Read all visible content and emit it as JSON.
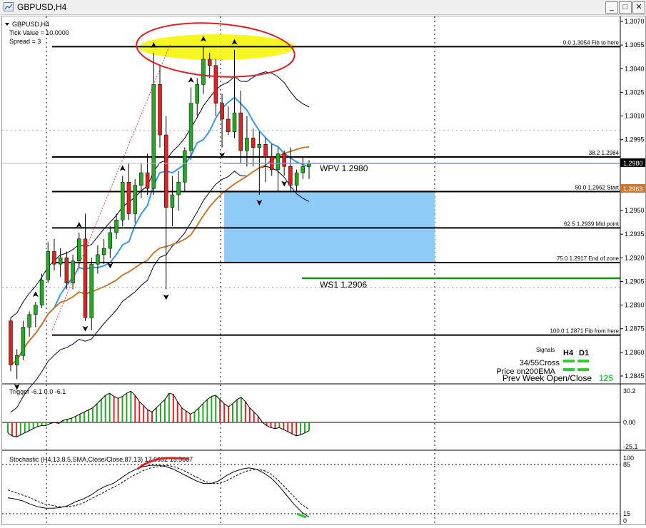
{
  "window": {
    "title": "GBPUSD,H4",
    "minimize": "_",
    "maximize": "□",
    "close": "✕"
  },
  "info": {
    "symbol": "GBPUSD,H4",
    "tick_value": "Tick Value = 10.0000",
    "spread": "Spread = 3"
  },
  "price_axis": [
    "1.3070",
    "1.3055",
    "1.3040",
    "1.3025",
    "1.3010",
    "1.2995",
    "1.2980",
    "1.2965",
    "1.2950",
    "1.2935",
    "1.2920",
    "1.2905",
    "1.2890",
    "1.2875",
    "1.2860",
    "1.2845"
  ],
  "current_price_tag": "1.2980",
  "orange_price_tag": "1.2963",
  "fib_levels": [
    {
      "label": "0.0   1.3054   Fib to here",
      "price": 1.3054
    },
    {
      "label": "38.2  1.2984",
      "price": 1.2984
    },
    {
      "label": "50.0   1.2962   Start",
      "price": 1.2962
    },
    {
      "label": "62.5   1.2939   Mid point",
      "price": 1.2939
    },
    {
      "label": "75.0   1.2917   End of zone",
      "price": 1.2917
    },
    {
      "label": "100.0   1.2871   Fib from here",
      "price": 1.2871
    }
  ],
  "pivots": {
    "wpv": "WPV   1.2980",
    "ws1": "WS1   1.2906"
  },
  "signals": {
    "title": "Signals",
    "col1": "H4",
    "col2": "D1",
    "rows": [
      "34/55Cross",
      "Price on200EMA"
    ],
    "prev_week": "Prev Week Open/Close",
    "prev_week_value": "125",
    "colors": {
      "signal": "#33cc33",
      "value": "#2ecc40"
    }
  },
  "trigger": {
    "label": "Trigger -6.1 0.0 -6.1",
    "axis": [
      "30.2",
      "0.00",
      "-25.1"
    ]
  },
  "stochastic": {
    "label": "Stochastic (H4,13,8,5,SMA,Close/Close,87,13) 17.9932 13.5667",
    "axis": [
      "100",
      "85",
      "15",
      "0"
    ]
  },
  "candles": [
    {
      "o": 1.288,
      "h": 1.2882,
      "l": 1.2848,
      "c": 1.2852
    },
    {
      "o": 1.2852,
      "h": 1.2862,
      "l": 1.2843,
      "c": 1.2858
    },
    {
      "o": 1.2858,
      "h": 1.288,
      "l": 1.2855,
      "c": 1.2876
    },
    {
      "o": 1.2876,
      "h": 1.2886,
      "l": 1.287,
      "c": 1.2884
    },
    {
      "o": 1.2884,
      "h": 1.2892,
      "l": 1.2876,
      "c": 1.289
    },
    {
      "o": 1.289,
      "h": 1.291,
      "l": 1.2888,
      "c": 1.2906
    },
    {
      "o": 1.2906,
      "h": 1.293,
      "l": 1.2904,
      "c": 1.2924
    },
    {
      "o": 1.2924,
      "h": 1.2932,
      "l": 1.2912,
      "c": 1.2916
    },
    {
      "o": 1.2916,
      "h": 1.2926,
      "l": 1.2908,
      "c": 1.292
    },
    {
      "o": 1.292,
      "h": 1.2924,
      "l": 1.29,
      "c": 1.2904
    },
    {
      "o": 1.2904,
      "h": 1.2922,
      "l": 1.29,
      "c": 1.2918
    },
    {
      "o": 1.2918,
      "h": 1.2936,
      "l": 1.2914,
      "c": 1.2932
    },
    {
      "o": 1.2932,
      "h": 1.2948,
      "l": 1.288,
      "c": 1.2882
    },
    {
      "o": 1.2882,
      "h": 1.292,
      "l": 1.2874,
      "c": 1.2916
    },
    {
      "o": 1.2916,
      "h": 1.2928,
      "l": 1.291,
      "c": 1.2922
    },
    {
      "o": 1.2922,
      "h": 1.2932,
      "l": 1.2916,
      "c": 1.2926
    },
    {
      "o": 1.2926,
      "h": 1.294,
      "l": 1.292,
      "c": 1.2936
    },
    {
      "o": 1.2936,
      "h": 1.2948,
      "l": 1.2932,
      "c": 1.2944
    },
    {
      "o": 1.2944,
      "h": 1.2972,
      "l": 1.294,
      "c": 1.2968
    },
    {
      "o": 1.2968,
      "h": 1.298,
      "l": 1.2944,
      "c": 1.2948
    },
    {
      "o": 1.2948,
      "h": 1.297,
      "l": 1.2942,
      "c": 1.2966
    },
    {
      "o": 1.2966,
      "h": 1.298,
      "l": 1.2958,
      "c": 1.2974
    },
    {
      "o": 1.2974,
      "h": 1.2986,
      "l": 1.296,
      "c": 1.2964
    },
    {
      "o": 1.2964,
      "h": 1.305,
      "l": 1.296,
      "c": 1.303
    },
    {
      "o": 1.303,
      "h": 1.3042,
      "l": 1.299,
      "c": 1.2998
    },
    {
      "o": 1.2998,
      "h": 1.301,
      "l": 1.29,
      "c": 1.2952
    },
    {
      "o": 1.2952,
      "h": 1.2972,
      "l": 1.294,
      "c": 1.296
    },
    {
      "o": 1.296,
      "h": 1.2975,
      "l": 1.295,
      "c": 1.2968
    },
    {
      "o": 1.2968,
      "h": 1.299,
      "l": 1.2962,
      "c": 1.2988
    },
    {
      "o": 1.2988,
      "h": 1.3028,
      "l": 1.2982,
      "c": 1.3018
    },
    {
      "o": 1.3018,
      "h": 1.3034,
      "l": 1.301,
      "c": 1.303
    },
    {
      "o": 1.303,
      "h": 1.3054,
      "l": 1.3024,
      "c": 1.3046
    },
    {
      "o": 1.3046,
      "h": 1.305,
      "l": 1.3034,
      "c": 1.3042
    },
    {
      "o": 1.3042,
      "h": 1.3046,
      "l": 1.301,
      "c": 1.3018
    },
    {
      "o": 1.3018,
      "h": 1.3024,
      "l": 1.299,
      "c": 1.3008
    },
    {
      "o": 1.3008,
      "h": 1.3016,
      "l": 1.2998,
      "c": 1.3
    },
    {
      "o": 1.3,
      "h": 1.3052,
      "l": 1.2996,
      "c": 1.3012
    },
    {
      "o": 1.3012,
      "h": 1.3026,
      "l": 1.298,
      "c": 1.2988
    },
    {
      "o": 1.2988,
      "h": 1.301,
      "l": 1.2978,
      "c": 1.2996
    },
    {
      "o": 1.2996,
      "h": 1.3002,
      "l": 1.2978,
      "c": 1.299
    },
    {
      "o": 1.299,
      "h": 1.3,
      "l": 1.296,
      "c": 1.2992
    },
    {
      "o": 1.2992,
      "h": 1.2996,
      "l": 1.2968,
      "c": 1.2984
    },
    {
      "o": 1.2984,
      "h": 1.2992,
      "l": 1.2972,
      "c": 1.2976
    },
    {
      "o": 1.2976,
      "h": 1.299,
      "l": 1.2962,
      "c": 1.2986
    },
    {
      "o": 1.2986,
      "h": 1.2988,
      "l": 1.2972,
      "c": 1.2978
    },
    {
      "o": 1.2978,
      "h": 1.299,
      "l": 1.2962,
      "c": 1.2966
    },
    {
      "o": 1.2966,
      "h": 1.2976,
      "l": 1.2962,
      "c": 1.2974
    },
    {
      "o": 1.2974,
      "h": 1.2984,
      "l": 1.297,
      "c": 1.2978
    },
    {
      "o": 1.2978,
      "h": 1.2982,
      "l": 1.297,
      "c": 1.298
    }
  ],
  "trigger_values": [
    -10,
    -13,
    -14,
    -12,
    -10,
    -8,
    -6,
    -4,
    -3,
    -3,
    -1,
    0,
    -1,
    2,
    3,
    4,
    6,
    8,
    10,
    12,
    14,
    18,
    22,
    26,
    28,
    25,
    23,
    25,
    28,
    30,
    26,
    20,
    16,
    12,
    10,
    14,
    18,
    22,
    28,
    27,
    20,
    14,
    11,
    8,
    10,
    14,
    18,
    22,
    25,
    26,
    22,
    18,
    15,
    18,
    22,
    24,
    20,
    14,
    10,
    6,
    0,
    -3,
    -5,
    -6,
    -5,
    -7,
    -9,
    -11,
    -13,
    -12,
    -10,
    -8
  ]
}
